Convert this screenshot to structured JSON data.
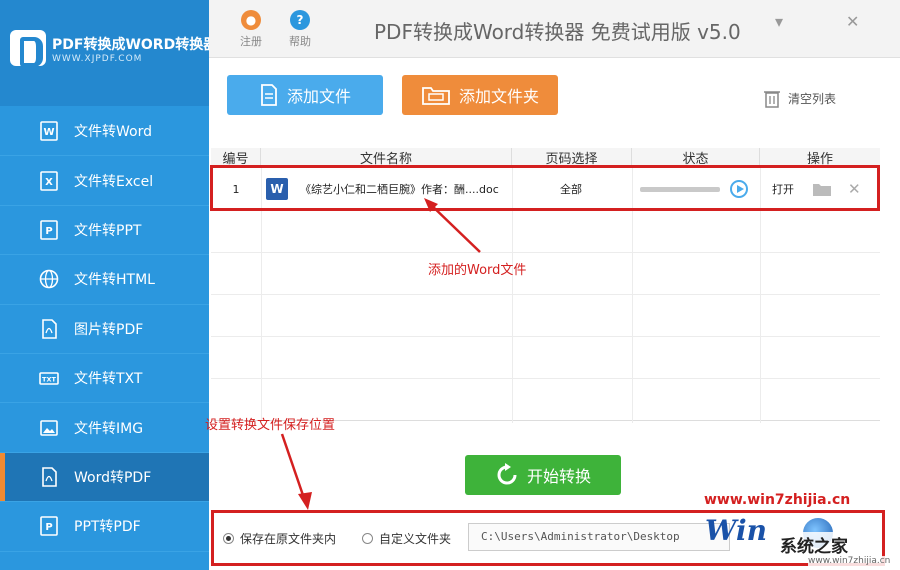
{
  "sidebar": {
    "logo_title": "PDF转换成WORD转换器",
    "logo_sub": "WWW.XJPDF.COM",
    "items": [
      {
        "label": "文件转Word",
        "icon": "word-doc-icon"
      },
      {
        "label": "文件转Excel",
        "icon": "excel-doc-icon"
      },
      {
        "label": "文件转PPT",
        "icon": "ppt-doc-icon"
      },
      {
        "label": "文件转HTML",
        "icon": "globe-icon"
      },
      {
        "label": "图片转PDF",
        "icon": "pdf-doc-icon"
      },
      {
        "label": "文件转TXT",
        "icon": "txt-doc-icon"
      },
      {
        "label": "文件转IMG",
        "icon": "image-icon"
      },
      {
        "label": "Word转PDF",
        "icon": "pdf-doc-icon",
        "active": true
      },
      {
        "label": "PPT转PDF",
        "icon": "ppt-pdf-icon"
      }
    ]
  },
  "topbar": {
    "register_label": "注册",
    "help_label": "帮助",
    "title": "PDF转换成Word转换器 免费试用版 v5.0",
    "minimize": "▾",
    "close": "✕"
  },
  "toolbar": {
    "add_file_label": "添加文件",
    "add_folder_label": "添加文件夹",
    "clear_list_label": "清空列表"
  },
  "table": {
    "headers": [
      "编号",
      "文件名称",
      "页码选择",
      "状态",
      "操作"
    ],
    "rows": [
      {
        "num": "1",
        "name": "《综艺小仁和二栖巨腕》作者：酬....doc",
        "page": "全部",
        "progress": 0,
        "open_label": "打开"
      }
    ]
  },
  "annotations": {
    "added_word": "添加的Word文件",
    "save_location": "设置转换文件保存位置"
  },
  "bottom": {
    "start_label": "开始转换",
    "save_original_label": "保存在原文件夹内",
    "custom_folder_label": "自定义文件夹",
    "path_value": "C:\\Users\\Administrator\\Desktop"
  },
  "watermark": {
    "url_top": "www.win7zhijia.cn",
    "win": "Win",
    "text": "系统之家",
    "url_bottom": "www.win7zhijia.cn"
  },
  "colors": {
    "sidebar_bg": "#2b97de",
    "accent_blue": "#4aabec",
    "accent_orange": "#ef8c3b",
    "start_green": "#3eb33a",
    "annotation_red": "#d42020"
  }
}
